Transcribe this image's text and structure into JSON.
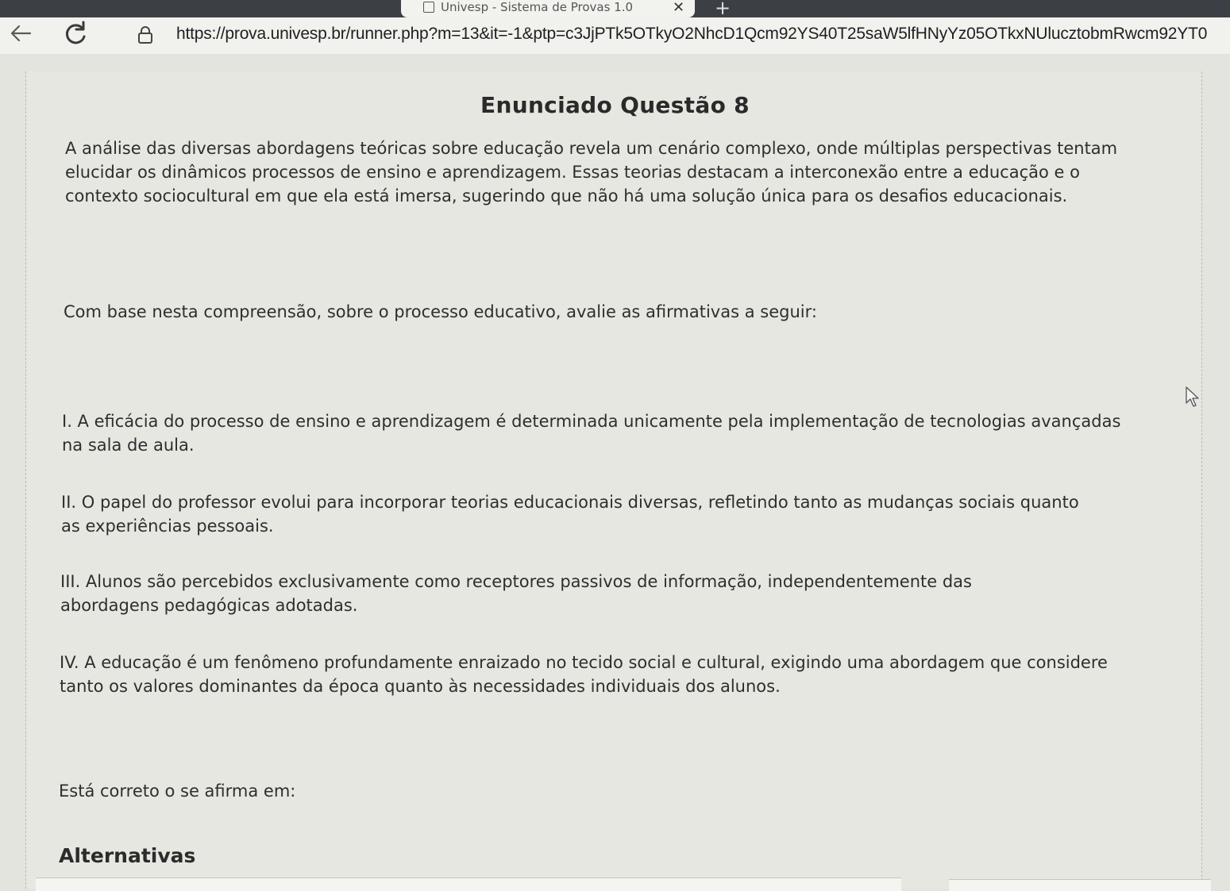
{
  "browser": {
    "tab": {
      "title": "Univesp - Sistema de Provas 1.0",
      "close_symbol": "✕",
      "icon": "page-icon"
    },
    "new_tab_symbol": "+",
    "toolbar": {
      "back_icon": "back-arrow-icon",
      "reload_icon": "reload-icon",
      "lock_icon": "lock-icon",
      "url": "https://prova.univesp.br/runner.php?m=13&it=-1&ptp=c3JjPTk5OTkyO2NhcD1Qcm92YS40T25saW5lfHNyYz05OTkxNUlucztobmRwcm92YT0"
    }
  },
  "question": {
    "heading": "Enunciado Questão 8",
    "intro": "A análise das diversas abordagens teóricas sobre educação revela um cenário complexo, onde múltiplas perspectivas tentam elucidar os dinâmicos processos de ensino e aprendizagem. Essas teorias destacam a interconexão entre a educação e o contexto sociocultural em que ela está imersa, sugerindo que não há uma solução única para os desafios educacionais.",
    "base": "Com base nesta compreensão, sobre o processo educativo, avalie as afirmativas a seguir:",
    "statements": [
      "I. A eficácia do processo de ensino e aprendizagem é determinada unicamente pela implementação de tecnologias avançadas na sala de aula.",
      "II. O papel do professor evolui para incorporar teorias educacionais diversas, refletindo tanto as mudanças sociais quanto as experiências pessoais.",
      "III. Alunos são percebidos exclusivamente como receptores passivos de informação, independentemente das abordagens pedagógicas adotadas.",
      "IV. A educação é um fenômeno profundamente enraizado no tecido social e cultural, exigindo uma abordagem que considere tanto os valores dominantes da época quanto às necessidades individuais dos alunos."
    ],
    "prompt": "Está correto o se afirma em:",
    "alternatives_label": "Alternativas"
  },
  "colors": {
    "chrome_dark": "#3c3f44",
    "toolbar": "#f1f1ee",
    "page_bg": "#e4e4df",
    "text": "#2e2e2e"
  }
}
